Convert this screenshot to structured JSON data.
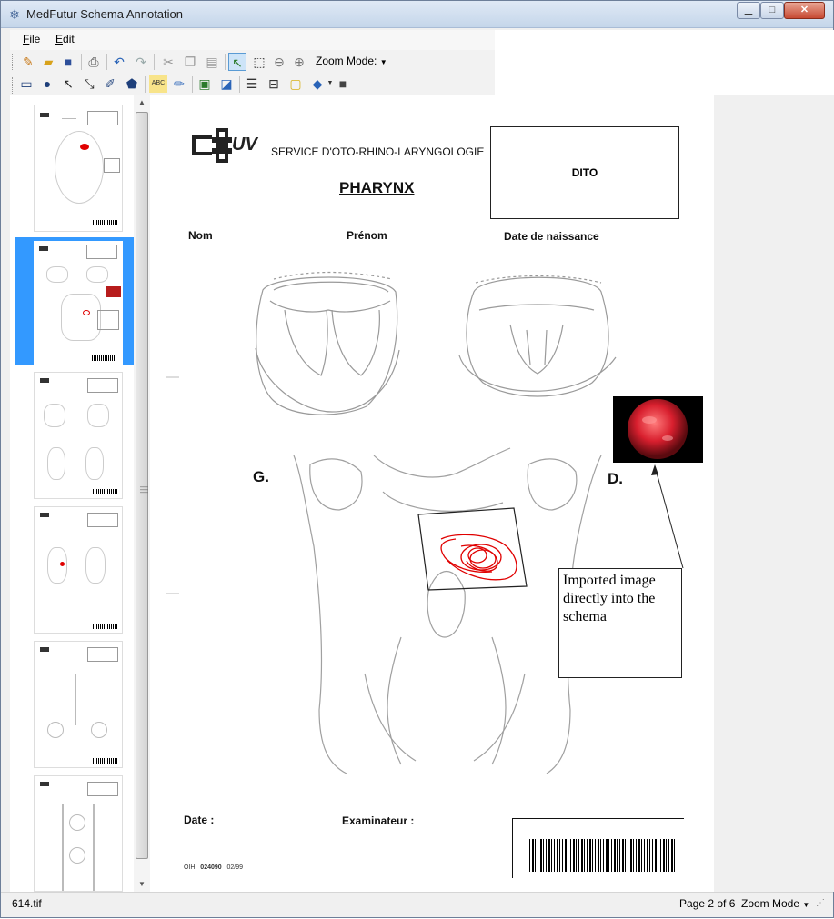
{
  "window": {
    "title": "MedFutur Schema Annotation",
    "app_icon": "snowflake-icon"
  },
  "menu": {
    "file": "File",
    "edit": "Edit"
  },
  "toolbar": {
    "zoom_mode": "Zoom Mode:"
  },
  "page": {
    "service": "SERVICE D'OTO-RHINO-LARYNGOLOGIE",
    "title": "PHARYNX",
    "dito": "DITO",
    "nom": "Nom",
    "prenom": "Prénom",
    "date_naissance": "Date de naissance",
    "side_g": "G.",
    "side_d": "D.",
    "date": "Date :",
    "examinateur": "Examinateur :",
    "footer_prefix": "OIH",
    "footer_code": "024090",
    "footer_date": "02/99",
    "annotation": "Imported image directly into the schema"
  },
  "status": {
    "file": "614.tif",
    "page": "Page 2 of 6",
    "zoom": "Zoom Mode"
  },
  "colors": {
    "selection": "#3399ff",
    "annotation_red": "#e00000"
  }
}
